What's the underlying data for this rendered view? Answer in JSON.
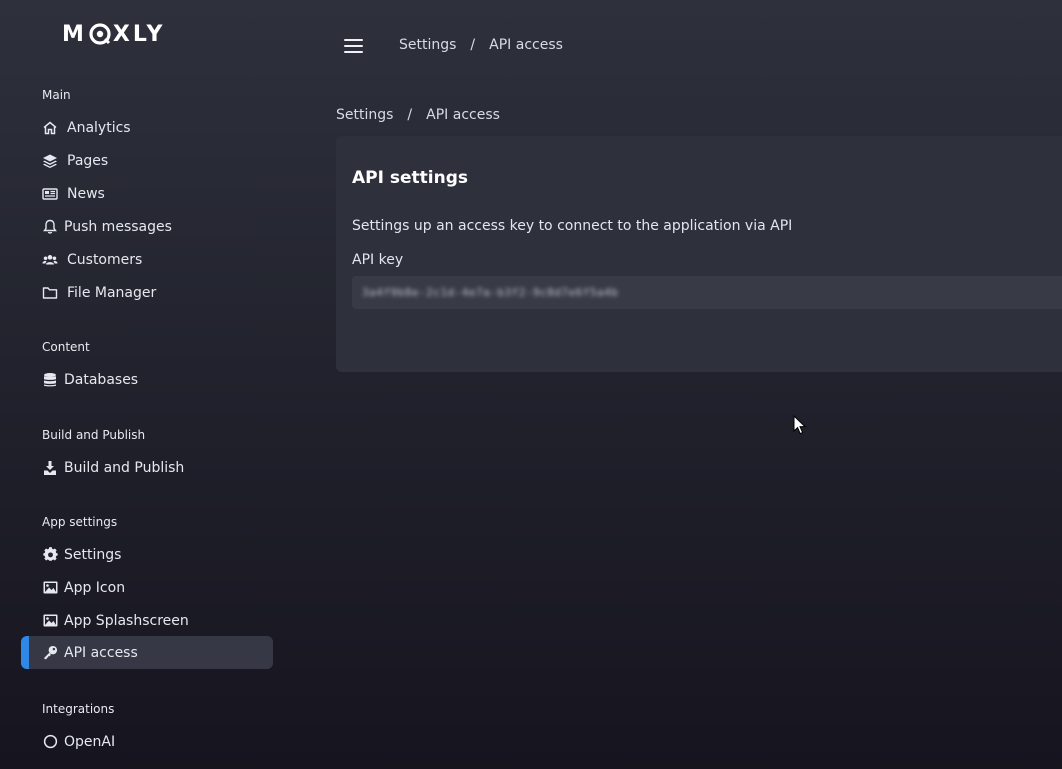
{
  "brand": {
    "logo_text_left": "M",
    "logo_text_right": "XLY"
  },
  "header": {
    "breadcrumb": [
      "Settings",
      "API access"
    ],
    "separator": "/"
  },
  "sidebar": {
    "sections": [
      {
        "label": "Main",
        "items": [
          {
            "label": "Analytics",
            "icon": "home-icon"
          },
          {
            "label": "Pages",
            "icon": "layers-icon"
          },
          {
            "label": "News",
            "icon": "newspaper-icon"
          },
          {
            "label": "Push messages",
            "icon": "bell-icon"
          },
          {
            "label": "Customers",
            "icon": "users-icon"
          },
          {
            "label": "File Manager",
            "icon": "folder-icon"
          }
        ]
      },
      {
        "label": "Content",
        "items": [
          {
            "label": "Databases",
            "icon": "database-icon"
          }
        ]
      },
      {
        "label": "Build and Publish",
        "items": [
          {
            "label": "Build and Publish",
            "icon": "download-icon"
          }
        ]
      },
      {
        "label": "App settings",
        "items": [
          {
            "label": "Settings",
            "icon": "gear-icon"
          },
          {
            "label": "App Icon",
            "icon": "image-icon"
          },
          {
            "label": "App Splashscreen",
            "icon": "image-icon"
          },
          {
            "label": "API access",
            "icon": "key-icon",
            "active": true
          }
        ]
      },
      {
        "label": "Integrations",
        "items": [
          {
            "label": "OpenAI",
            "icon": "openai-icon"
          }
        ]
      }
    ]
  },
  "page": {
    "breadcrumb": [
      "Settings",
      "API access"
    ],
    "card": {
      "title": "API settings",
      "description": "Settings up an access key to connect to the application via API",
      "api_key_label": "API key",
      "api_key_value": "3a4f9b8e-2c1d-4e7a-b3f2-9c8d7e6f5a4b"
    }
  },
  "colors": {
    "accent": "#2f88e8",
    "active_item_bg": "#363945",
    "card_bg": "#2e303b",
    "input_bg": "#383a46"
  }
}
